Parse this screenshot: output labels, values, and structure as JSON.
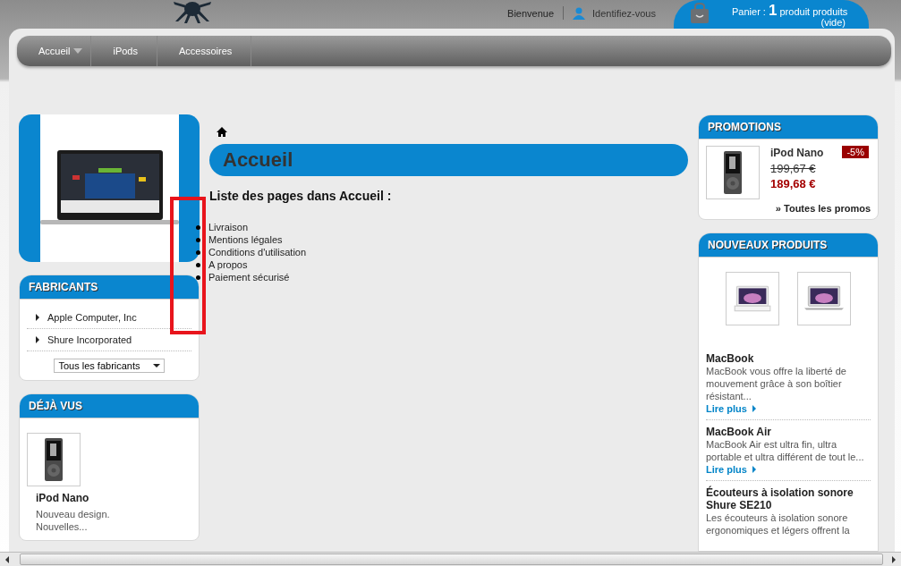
{
  "header": {
    "welcome": "Bienvenue",
    "login": "Identifiez-vous",
    "cart": {
      "label": "Panier :",
      "count": "1",
      "unit": "produit produits",
      "state": "(vide)"
    }
  },
  "nav": [
    {
      "label": "Accueil",
      "dropdown": true
    },
    {
      "label": "iPods",
      "dropdown": false
    },
    {
      "label": "Accessoires",
      "dropdown": false
    }
  ],
  "left": {
    "manufacturers": {
      "title": "FABRICANTS",
      "items": [
        "Apple Computer, Inc",
        "Shure Incorporated"
      ],
      "select": "Tous les fabricants"
    },
    "viewed": {
      "title": "DÉJÀ VUS",
      "items": [
        {
          "name": "iPod Nano",
          "description": "Nouveau design. Nouvelles..."
        }
      ]
    }
  },
  "main": {
    "title": "Accueil",
    "subtitle": "Liste des pages dans Accueil :",
    "pages": [
      "Livraison",
      "Mentions légales",
      "Conditions d'utilisation",
      "A propos",
      "Paiement sécurisé"
    ]
  },
  "right": {
    "promotions": {
      "title": "PROMOTIONS",
      "item": {
        "name": "iPod Nano",
        "old_price": "199,67 €",
        "price": "189,68 €",
        "discount": "-5%"
      },
      "all_link": "» Toutes les promos"
    },
    "new_products": {
      "title": "NOUVEAUX PRODUITS",
      "items": [
        {
          "name": "MacBook",
          "description": "MacBook vous offre la liberté de mouvement grâce à son boîtier résistant...",
          "link": "Lire plus"
        },
        {
          "name": "MacBook Air",
          "description": "MacBook Air est ultra fin, ultra portable et ultra différent de tout le...",
          "link": "Lire plus"
        },
        {
          "name": "Écouteurs à isolation sonore Shure SE210",
          "description": "Les écouteurs à isolation sonore ergonomiques et légers offrent la"
        }
      ]
    }
  }
}
